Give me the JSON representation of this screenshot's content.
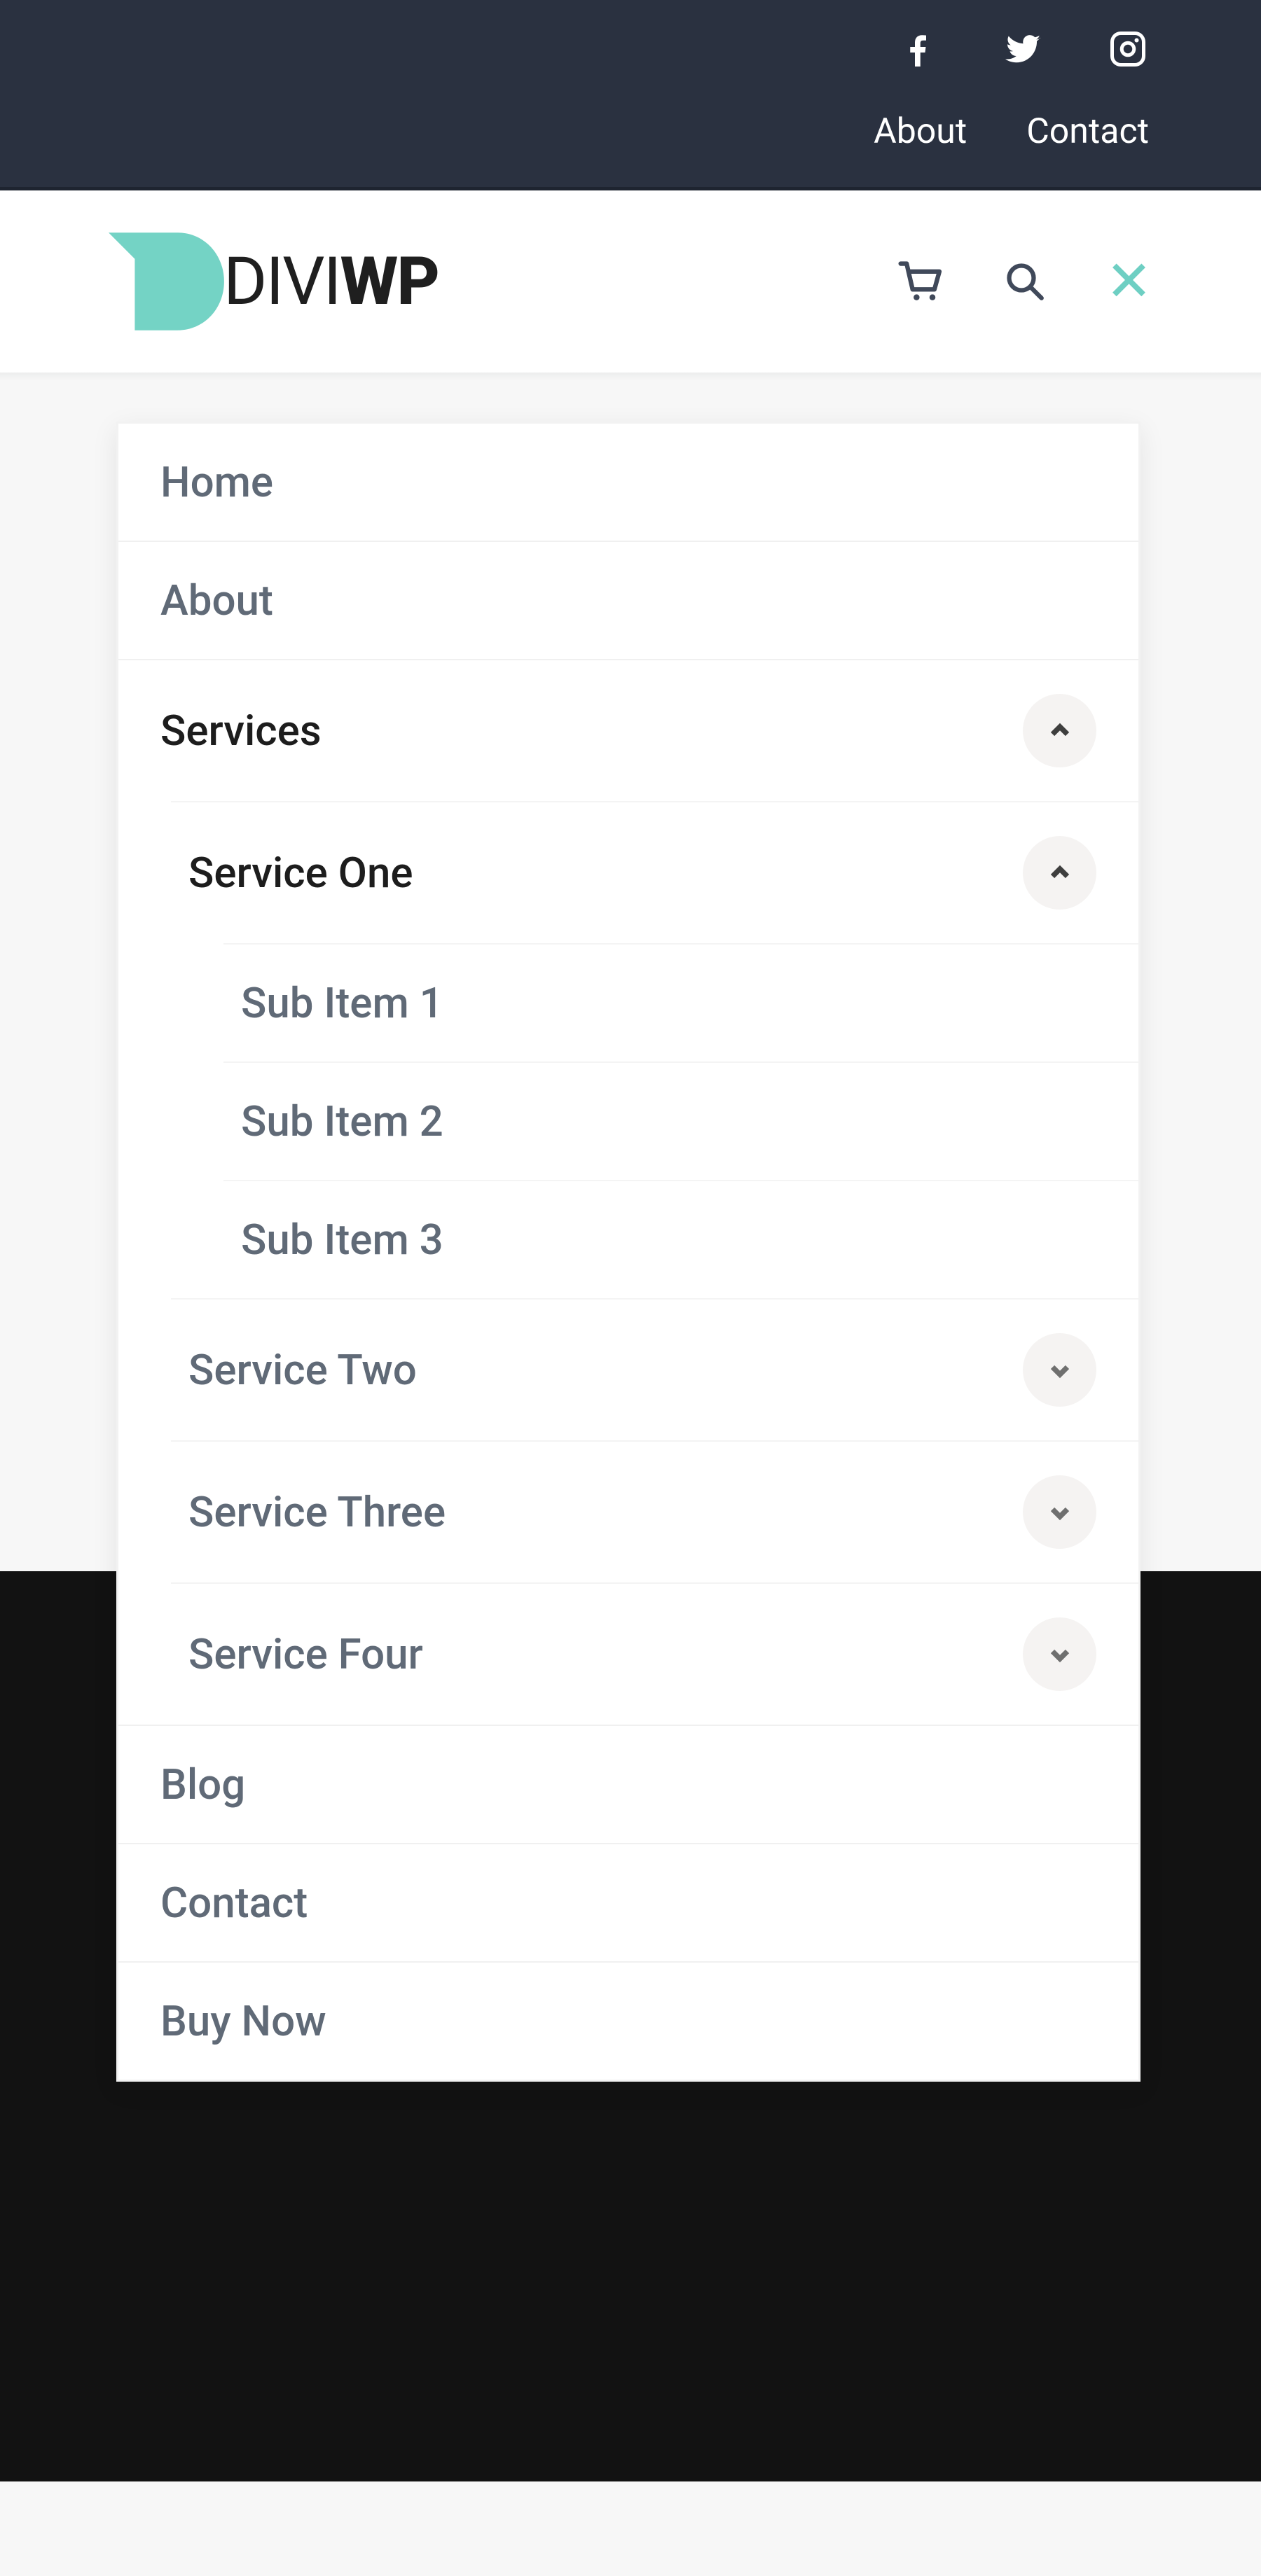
{
  "topbar": {
    "links": {
      "about": "About",
      "contact": "Contact"
    }
  },
  "logo": {
    "part1": "DIVI",
    "part2": "WP"
  },
  "menu": {
    "home": "Home",
    "about": "About",
    "services": {
      "label": "Services",
      "service_one": {
        "label": "Service One",
        "sub1": "Sub Item 1",
        "sub2": "Sub Item 2",
        "sub3": "Sub Item 3"
      },
      "service_two": "Service Two",
      "service_three": "Service Three",
      "service_four": "Service Four"
    },
    "blog": "Blog",
    "contact": "Contact",
    "buy_now": "Buy Now"
  }
}
